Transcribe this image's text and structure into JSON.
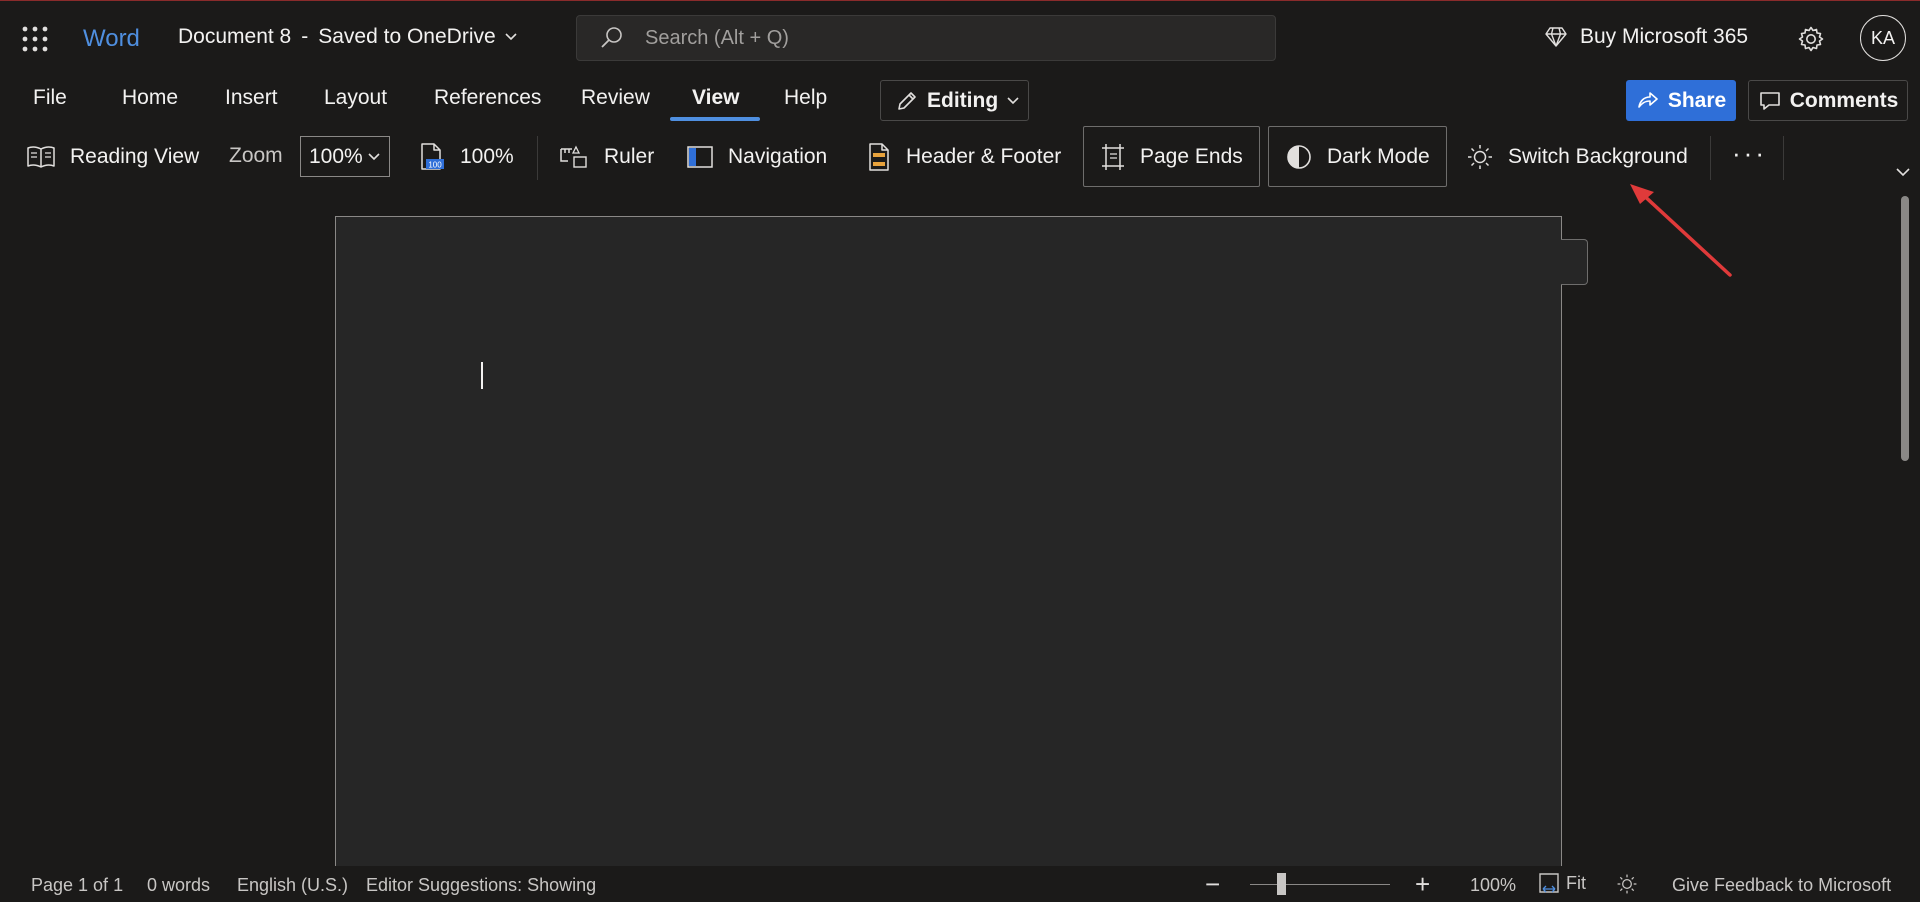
{
  "titlebar": {
    "app_name": "Word",
    "doc_name": "Document 8",
    "separator": "-",
    "save_status": "Saved to OneDrive",
    "search_placeholder": "Search (Alt + Q)",
    "buy_label": "Buy Microsoft 365",
    "avatar_initials": "KA"
  },
  "menubar": {
    "tabs": [
      {
        "label": "File"
      },
      {
        "label": "Home"
      },
      {
        "label": "Insert"
      },
      {
        "label": "Layout"
      },
      {
        "label": "References"
      },
      {
        "label": "Review"
      },
      {
        "label": "View",
        "active": true
      },
      {
        "label": "Help"
      }
    ],
    "editing_label": "Editing",
    "share_label": "Share",
    "comments_label": "Comments"
  },
  "ribbon": {
    "reading_view": "Reading View",
    "zoom_label": "Zoom",
    "zoom_value": "100%",
    "zoom_100": "100%",
    "zoom_100_badge": "100",
    "ruler": "Ruler",
    "navigation": "Navigation",
    "header_footer": "Header & Footer",
    "page_ends": "Page Ends",
    "dark_mode": "Dark Mode",
    "switch_background": "Switch Background",
    "more": "···"
  },
  "statusbar": {
    "page": "Page 1 of 1",
    "words": "0 words",
    "language": "English (U.S.)",
    "editor": "Editor Suggestions: Showing",
    "zoom_minus": "−",
    "zoom_plus": "+",
    "zoom_percent": "100%",
    "fit": "Fit",
    "feedback": "Give Feedback to Microsoft"
  },
  "colors": {
    "accent": "#4f8fe0",
    "share": "#2f6fd8",
    "background": "#1b1a19",
    "page": "#262626",
    "annotation_arrow": "#e03a3a"
  }
}
